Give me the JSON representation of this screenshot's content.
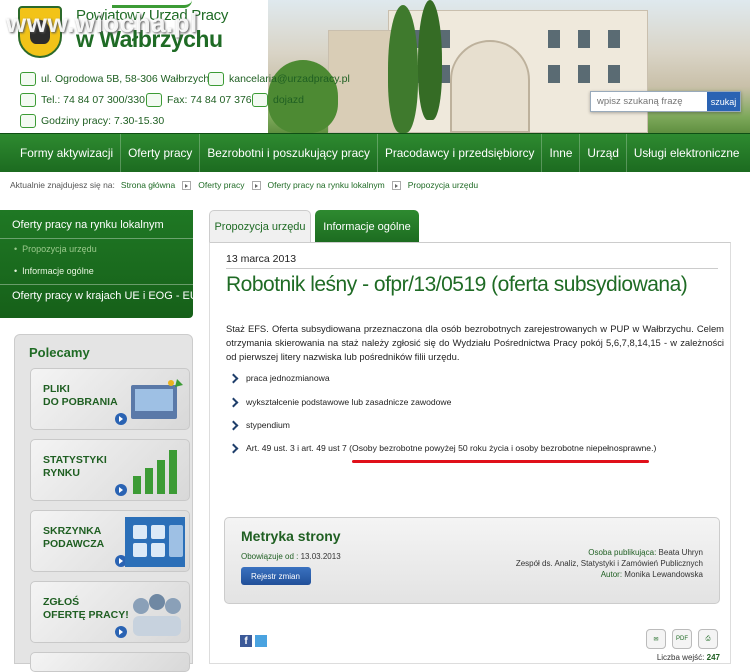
{
  "watermark": "www.wiocha.pl",
  "logo": {
    "line1": "Powiatowy Urząd Pracy",
    "line2": "w Wałbrzychu"
  },
  "contact": {
    "address": "ul. Ogrodowa 5B, 58-306 Wałbrzych",
    "email": "kancelaria@urzadpracy.pl",
    "tel": "Tel.: 74 84 07 300/330",
    "fax": "Fax: 74 84 07 376",
    "dojazd": "dojazd",
    "hours": "Godziny pracy: 7.30-15.30"
  },
  "search": {
    "placeholder": "wpisz szukaną frazę",
    "button": "szukaj"
  },
  "nav": [
    "Formy aktywizacji",
    "Oferty pracy",
    "Bezrobotni i poszukujący pracy",
    "Pracodawcy i przedsiębiorcy",
    "Inne",
    "Urząd",
    "Usługi elektroniczne"
  ],
  "breadcrumb": {
    "prefix": "Aktualnie znajdujesz się na:",
    "items": [
      "Strona główna",
      "Oferty pracy",
      "Oferty pracy na rynku lokalnym",
      "Propozycja urzędu"
    ]
  },
  "sidebar": {
    "item1": "Oferty pracy na rynku lokalnym",
    "sub1": "Propozycja urzędu",
    "sub2": "Informacje ogólne",
    "item2": "Oferty pracy w krajach UE i EOG - EURES"
  },
  "polecamy": {
    "title": "Polecamy",
    "tiles": [
      "PLIKI\nDO POBRANIA",
      "STATYSTYKI\nRYNKU",
      "SKRZYNKA\nPODAWCZA",
      "ZGŁOŚ\nOFERTĘ PRACY!"
    ]
  },
  "tabs": {
    "active": "Propozycja urzędu",
    "other": "Informacje ogólne"
  },
  "article": {
    "date": "13 marca 2013",
    "title": "Robotnik leśny - ofpr/13/0519 (oferta subsydiowana)",
    "description": "Staż EFS. Oferta subsydiowana przeznaczona dla osób bezrobotnych zarejestrowanych w PUP w Wałbrzychu. Celem otrzymania skierowania na staż należy zgłosić się do Wydziału Pośrednictwa Pracy pokój 5,6,7,8,14,15 - w zależności od pierwszej litery nazwiska lub pośredników filii urzędu.",
    "bullets": [
      "praca jednozmianowa",
      "wykształcenie podstawowe lub zasadnicze zawodowe",
      "stypendium",
      "Art. 49 ust. 3 i art. 49 ust 7 (Osoby bezrobotne powyżej 50 roku życia i osoby bezrobotne niepełnosprawne.)"
    ]
  },
  "metryka": {
    "title": "Metryka strony",
    "valid_label": "Obowiązuje od :",
    "valid_date": "13.03.2013",
    "button": "Rejestr zmian",
    "pub_label": "Osoba publikująca:",
    "pub_name": "Beata Uhryn",
    "team": "Zespół ds. Analiz, Statystyki i Zamówień Publicznych",
    "author_label": "Autor:",
    "author_name": "Monika Lewandowska"
  },
  "footer": {
    "views_label": "Liczba wejść:",
    "views": "247",
    "pdf": "PDF"
  },
  "colors": {
    "brand_green": "#1f6b25",
    "accent_red": "#e0101a",
    "button_blue": "#2a63b3"
  }
}
